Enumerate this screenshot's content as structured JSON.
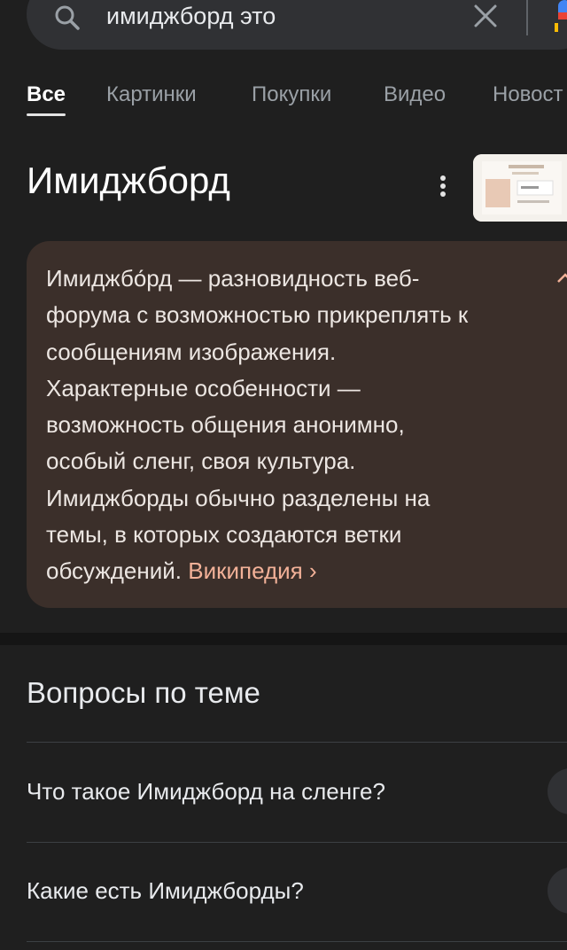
{
  "search": {
    "query": "имиджборд это",
    "search_icon": "search-icon",
    "clear_icon": "close-icon",
    "voice_icon": "mic-icon"
  },
  "tabs": [
    {
      "label": "Все",
      "active": true
    },
    {
      "label": "Картинки",
      "active": false
    },
    {
      "label": "Покупки",
      "active": false
    },
    {
      "label": "Видео",
      "active": false
    },
    {
      "label": "Новост",
      "active": false
    }
  ],
  "knowledge": {
    "title": "Имиджборд",
    "more_icon": "more-vert-icon",
    "description_lines": [
      "Имиджбо́рд — разновидность веб-",
      "форума с возможностью прикреплять к",
      "сообщениям изображения.",
      "Характерные особенности —",
      "возможность общения анонимно,",
      "особый сленг, своя культура.",
      "Имиджборды обычно разделены на",
      "темы, в которых создаются ветки",
      "обсуждений."
    ],
    "source_link": "Википедия ›",
    "collapse_icon": "chevron-up-icon"
  },
  "related_questions": {
    "header": "Вопросы по теме",
    "items": [
      {
        "question": "Что такое Имиджборд на сленге?"
      },
      {
        "question": "Какие есть Имиджборды?"
      }
    ]
  },
  "colors": {
    "background": "#1f1f1f",
    "search_bar": "#303134",
    "card_background": "#3b2f2a",
    "link": "#f2b198",
    "text": "#e8eaed"
  }
}
